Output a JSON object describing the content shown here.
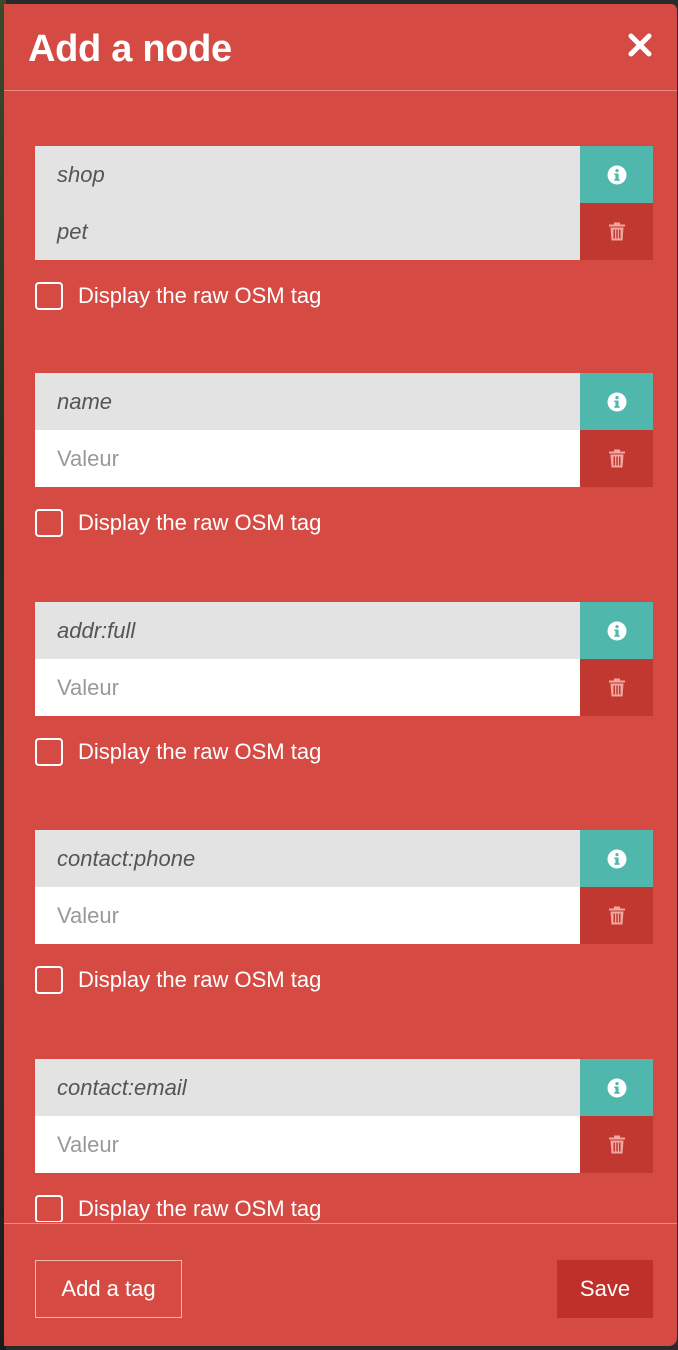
{
  "header": {
    "title": "Add a node",
    "close_icon": "close-icon"
  },
  "tags": [
    {
      "key": "shop",
      "value": "pet",
      "value_placeholder": "",
      "raw_label": "Display the raw OSM tag"
    },
    {
      "key": "name",
      "value": "",
      "value_placeholder": "Valeur",
      "raw_label": "Display the raw OSM tag"
    },
    {
      "key": "addr:full",
      "value": "",
      "value_placeholder": "Valeur",
      "raw_label": "Display the raw OSM tag"
    },
    {
      "key": "contact:phone",
      "value": "",
      "value_placeholder": "Valeur",
      "raw_label": "Display the raw OSM tag"
    },
    {
      "key": "contact:email",
      "value": "",
      "value_placeholder": "Valeur",
      "raw_label": "Display the raw OSM tag"
    }
  ],
  "footer": {
    "add_tag_label": "Add a tag",
    "save_label": "Save"
  },
  "colors": {
    "panel": "#d54b44",
    "info": "#50b7ad",
    "delete": "#c0382f",
    "save": "#c0302a"
  }
}
